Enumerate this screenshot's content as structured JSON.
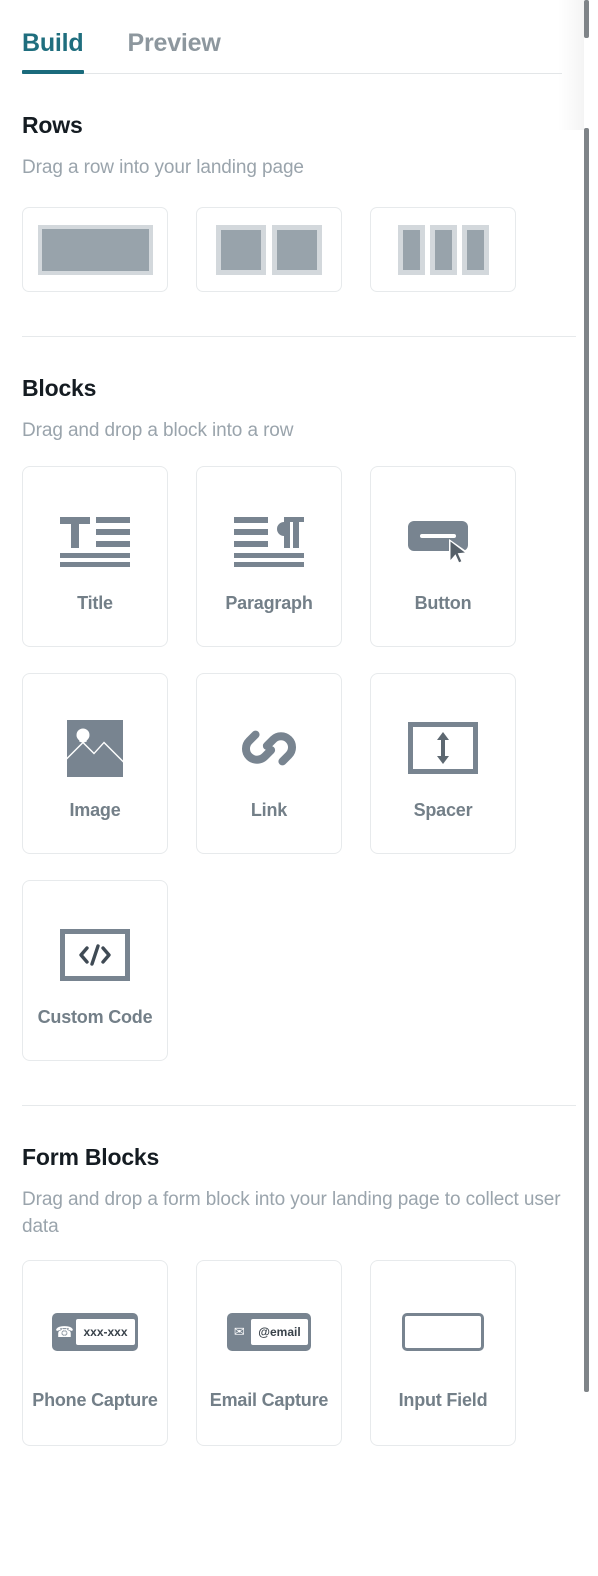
{
  "colors": {
    "accent": "#1a6b7c",
    "tab_inactive": "#8d979e",
    "heading": "#151c22",
    "subtext": "#9aa4ac",
    "icon": "#788490",
    "card_border": "#e7eaec",
    "divider": "#e6e9eb",
    "row_frame": "#d3d8dc",
    "row_fill": "#98a3ab"
  },
  "tabs": [
    {
      "label": "Build",
      "active": true
    },
    {
      "label": "Preview",
      "active": false
    }
  ],
  "rows_section": {
    "title": "Rows",
    "subtitle": "Drag a row into your landing page",
    "items": [
      {
        "name": "row-one-column",
        "columns": 1
      },
      {
        "name": "row-two-column",
        "columns": 2
      },
      {
        "name": "row-three-column",
        "columns": 3
      }
    ]
  },
  "blocks_section": {
    "title": "Blocks",
    "subtitle": "Drag and drop a block into a row",
    "items": [
      {
        "label": "Title",
        "icon": "title-icon"
      },
      {
        "label": "Paragraph",
        "icon": "paragraph-icon"
      },
      {
        "label": "Button",
        "icon": "button-icon"
      },
      {
        "label": "Image",
        "icon": "image-icon"
      },
      {
        "label": "Link",
        "icon": "link-icon"
      },
      {
        "label": "Spacer",
        "icon": "spacer-icon"
      },
      {
        "label": "Custom Code",
        "icon": "custom-code-icon"
      }
    ]
  },
  "form_blocks_section": {
    "title": "Form Blocks",
    "subtitle": "Drag and drop a form block into your landing page to collect user data",
    "items": [
      {
        "label": "Phone Capture",
        "icon": "phone-capture-icon",
        "chip_text": "xxx-xxx"
      },
      {
        "label": "Email Capture",
        "icon": "email-capture-icon",
        "chip_text": "@email"
      },
      {
        "label": "Input Field",
        "icon": "input-field-icon",
        "chip_text": ""
      }
    ]
  }
}
